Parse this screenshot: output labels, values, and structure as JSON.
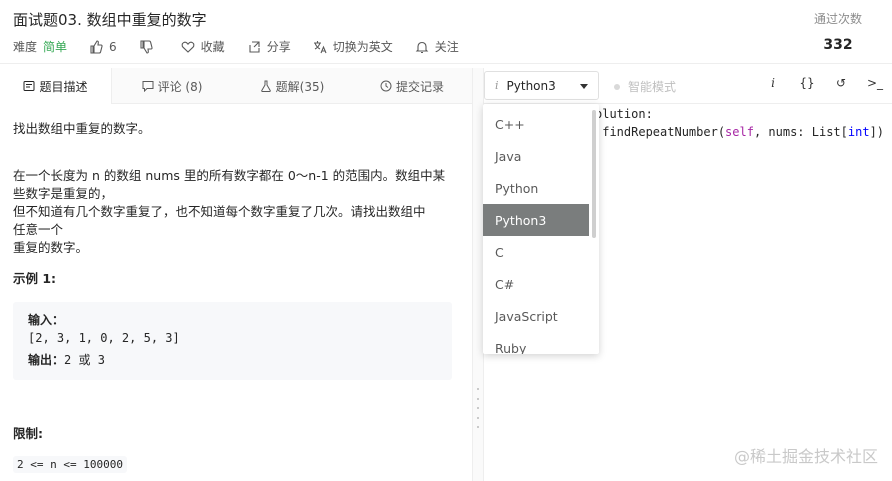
{
  "header": {
    "title": "面试题03. 数组中重复的数字",
    "difficulty_label": "难度",
    "difficulty": "简单",
    "likes": "6",
    "favorite": "收藏",
    "share": "分享",
    "switch_lang": "切换为英文",
    "follow": "关注",
    "pass_label": "通过次数",
    "pass_count": "332"
  },
  "tabs": [
    {
      "label": "题目描述"
    },
    {
      "label": "评论 (8)"
    },
    {
      "label": "题解(35)"
    },
    {
      "label": "提交记录"
    }
  ],
  "problem": {
    "heading": "找出数组中重复的数字。",
    "para1_l1": "在一个长度为 n 的数组 nums 里的所有数字都在 0～n-1 的范围内。数组中某",
    "para1_l2": "些数字是重复的，",
    "para2_l1": "但不知道有几个数字重复了，也不知道每个数字重复了几次。请找出数组中",
    "para2_l2": "任意一个",
    "para2_l3": "重复的数字。",
    "example_title": "示例 1:",
    "input_label": "输入：",
    "input_value": "[2, 3, 1, 0, 2, 5, 3]",
    "output_label": "输出：",
    "output_value": "2 或 3",
    "limits_title": "限制:",
    "limit_text": "2 <= n <= 100000"
  },
  "editor": {
    "language": "Python3",
    "smart_mode": "智能模式",
    "code_line1": "olution:",
    "code_line2_a": " findRepeatNumber(",
    "code_line2_self": "self",
    "code_line2_b": ", nums: List[",
    "code_line2_int": "int",
    "code_line2_c": "]) -",
    "toolbar_info": "i",
    "toolbar_braces": "{}",
    "toolbar_reset": "↺",
    "toolbar_console": ">_"
  },
  "language_options": [
    "C++",
    "Java",
    "Python",
    "Python3",
    "C",
    "C#",
    "JavaScript",
    "Ruby"
  ],
  "watermark": "@稀土掘金技术社区"
}
